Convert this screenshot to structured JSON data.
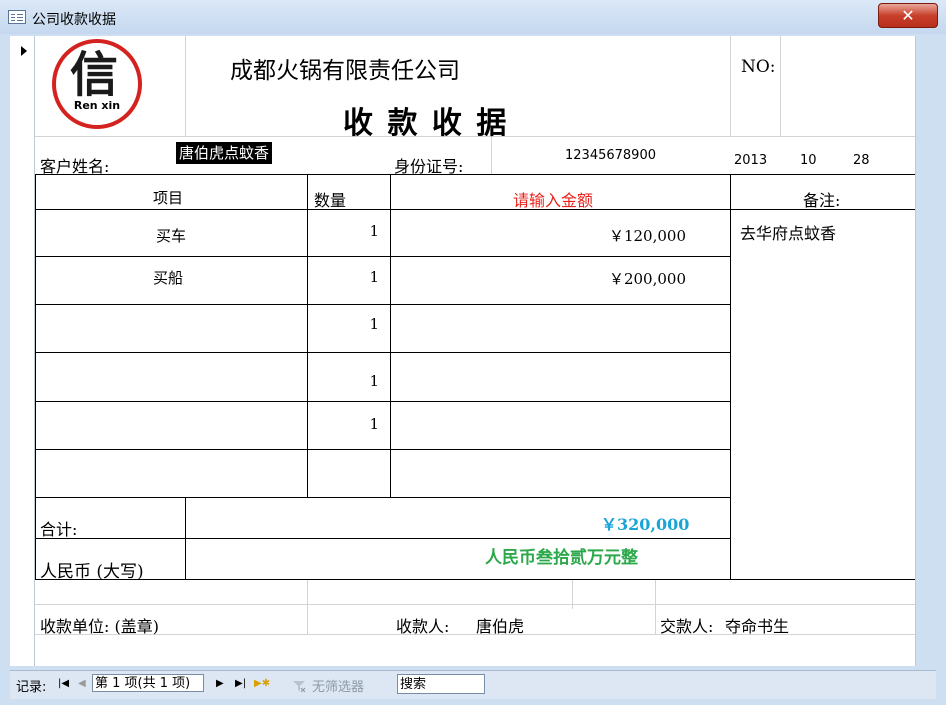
{
  "window": {
    "title": "公司收款收据",
    "close_symbol": "✕"
  },
  "header": {
    "company": "成都火锅有限责任公司",
    "receipt_title": "收 款 收 据",
    "no_label": "NO:",
    "logo_text": "Ren xin",
    "logo_glyph": "信"
  },
  "customer": {
    "name_label": "客户姓名:",
    "name_value": "唐伯虎点蚊香",
    "id_label": "身份证号:",
    "id_value": "12345678900",
    "date_year": "2013",
    "date_month": "10",
    "date_day": "28"
  },
  "table": {
    "col_item": "项目",
    "col_qty": "数量",
    "col_amount": "请输入金额",
    "col_remark": "备注:",
    "remark_value": "去华府点蚊香",
    "rows": [
      {
        "item": "买车",
        "qty": "1",
        "amount": "￥120,000"
      },
      {
        "item": "买船",
        "qty": "1",
        "amount": "￥200,000"
      },
      {
        "item": "",
        "qty": "1",
        "amount": ""
      },
      {
        "item": "",
        "qty": "1",
        "amount": ""
      },
      {
        "item": "",
        "qty": "1",
        "amount": ""
      },
      {
        "item": "",
        "qty": "",
        "amount": ""
      }
    ]
  },
  "totals": {
    "sum_label": "合计:",
    "sum_value": "￥320,000",
    "rmb_label": "人民币 (大写)",
    "rmb_value": "人民币叁拾贰万元整"
  },
  "footer": {
    "unit_label": "收款单位: (盖章)",
    "payee_label": "收款人:",
    "payee_value": "唐伯虎",
    "payer_label": "交款人:",
    "payer_value": "夺命书生"
  },
  "statusbar": {
    "record_label": "记录:",
    "record_value": "第 1 项(共 1 项)",
    "filter_label": "无筛选器",
    "search_label": "搜索"
  },
  "colors": {
    "amount_header": "#e8231c",
    "sum_value": "#1aa5d8",
    "rmb_value": "#2aa84a",
    "close_button": "#c8402c"
  }
}
